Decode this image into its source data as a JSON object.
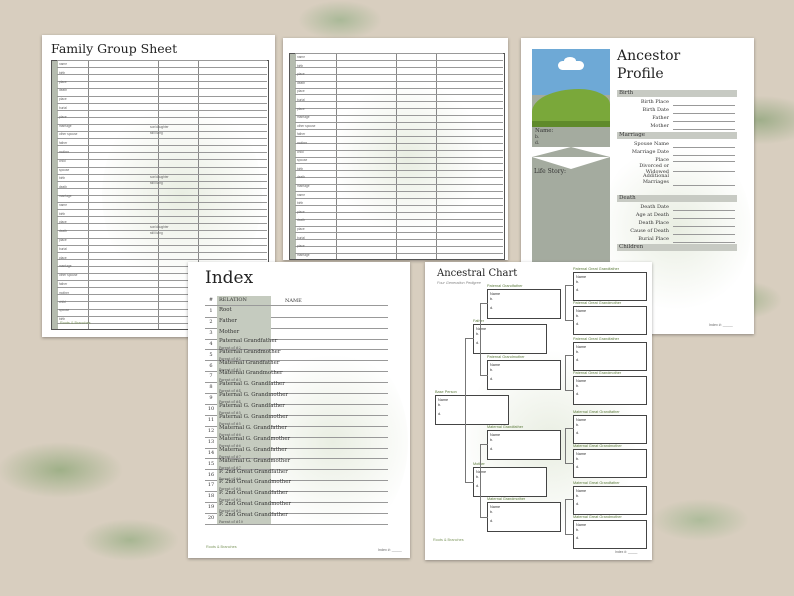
{
  "family_group_sheet": {
    "title": "Family Group Sheet",
    "labels": [
      "name",
      "birth",
      "place",
      "death",
      "place",
      "burial",
      "place",
      "marriage",
      "other spouse",
      "father",
      "mother",
      "child",
      "spouse",
      "birth",
      "death",
      "marriage"
    ],
    "checks": [
      "son/daughter",
      "still living"
    ],
    "logo": "Roots & Branches"
  },
  "ancestor_profile": {
    "title_line1": "Ancestor",
    "title_line2": "Profile",
    "name_label": "Name:",
    "b_label": "b.",
    "d_label": "d.",
    "life_story_label": "Life Story:",
    "sections": {
      "birth": "Birth",
      "marriage": "Marriage",
      "death": "Death",
      "children": "Children"
    },
    "birth_fields": [
      "Birth Place",
      "Birth Date",
      "Father",
      "Mother"
    ],
    "marriage_fields": [
      "Spouse Name",
      "Marriage Date",
      "Place",
      "Divorced or Widowed",
      "Additional Marriages"
    ],
    "death_fields": [
      "Death Date",
      "Age at Death",
      "Death Place",
      "Cause of Death",
      "Burial Place"
    ],
    "index_ref": "Index #: _____"
  },
  "index": {
    "title": "Index",
    "col_num": "#",
    "col_relation": "RELATION",
    "col_name": "NAME",
    "rows": [
      {
        "n": "1",
        "rel": "Root",
        "sub": ""
      },
      {
        "n": "2",
        "rel": "Father",
        "sub": ""
      },
      {
        "n": "3",
        "rel": "Mother",
        "sub": ""
      },
      {
        "n": "4",
        "rel": "Paternal Grandfather",
        "sub": "Parent of #2"
      },
      {
        "n": "5",
        "rel": "Paternal Grandmother",
        "sub": "Parent of #2"
      },
      {
        "n": "6",
        "rel": "Maternal Grandfather",
        "sub": "Parent of #3"
      },
      {
        "n": "7",
        "rel": "Maternal Grandmother",
        "sub": "Parent of #3"
      },
      {
        "n": "8",
        "rel": "Paternal G. Grandfather",
        "sub": "Parent of #4"
      },
      {
        "n": "9",
        "rel": "Paternal G. Grandmother",
        "sub": "Parent of #4"
      },
      {
        "n": "10",
        "rel": "Paternal G. Grandfather",
        "sub": "Parent of #5"
      },
      {
        "n": "11",
        "rel": "Paternal G. Grandmother",
        "sub": "Parent of #5"
      },
      {
        "n": "12",
        "rel": "Maternal G. Grandfather",
        "sub": "Parent of #6"
      },
      {
        "n": "13",
        "rel": "Maternal G. Grandmother",
        "sub": "Parent of #6"
      },
      {
        "n": "14",
        "rel": "Maternal G. Grandfather",
        "sub": "Parent of #7"
      },
      {
        "n": "15",
        "rel": "Maternal G. Grandmother",
        "sub": "Parent of #7"
      },
      {
        "n": "16",
        "rel": "P. 2nd Great Grandfather",
        "sub": "Parent of #8"
      },
      {
        "n": "17",
        "rel": "P. 2nd Great Grandmother",
        "sub": "Parent of #8"
      },
      {
        "n": "18",
        "rel": "P. 2nd Great Grandfather",
        "sub": "Parent of #9"
      },
      {
        "n": "19",
        "rel": "P. 2nd Great Grandmother",
        "sub": "Parent of #9"
      },
      {
        "n": "20",
        "rel": "P. 2nd Great Grandfather",
        "sub": "Parent of #10"
      }
    ],
    "logo": "Roots & Branches",
    "index_ref": "Index #: _____"
  },
  "ancestral_chart": {
    "title": "Ancestral Chart",
    "subtitle": "Four Generation Pedigree",
    "base_person": "Base Person",
    "father": "Father",
    "mother": "Mother",
    "paternal_grandfather": "Paternal Grandfather",
    "paternal_grandmother": "Paternal Grandmother",
    "maternal_grandfather": "Maternal Grandfather",
    "maternal_grandmother": "Maternal Grandmother",
    "great_labels": [
      "Paternal Great Grandfather",
      "Paternal Great Grandmother",
      "Paternal Great Grandfather",
      "Paternal Great Grandmother",
      "Maternal Great Grandfather",
      "Maternal Great Grandmother",
      "Maternal Great Grandfather",
      "Maternal Great Grandmother"
    ],
    "field_name": "Name",
    "field_b": "b.",
    "field_d": "d.",
    "logo": "Roots & Branches",
    "index_ref": "Index #: _____"
  },
  "colors": {
    "background": "#d8cebf",
    "sage": "#c5cbbf",
    "accent": "#5b7a3b"
  }
}
